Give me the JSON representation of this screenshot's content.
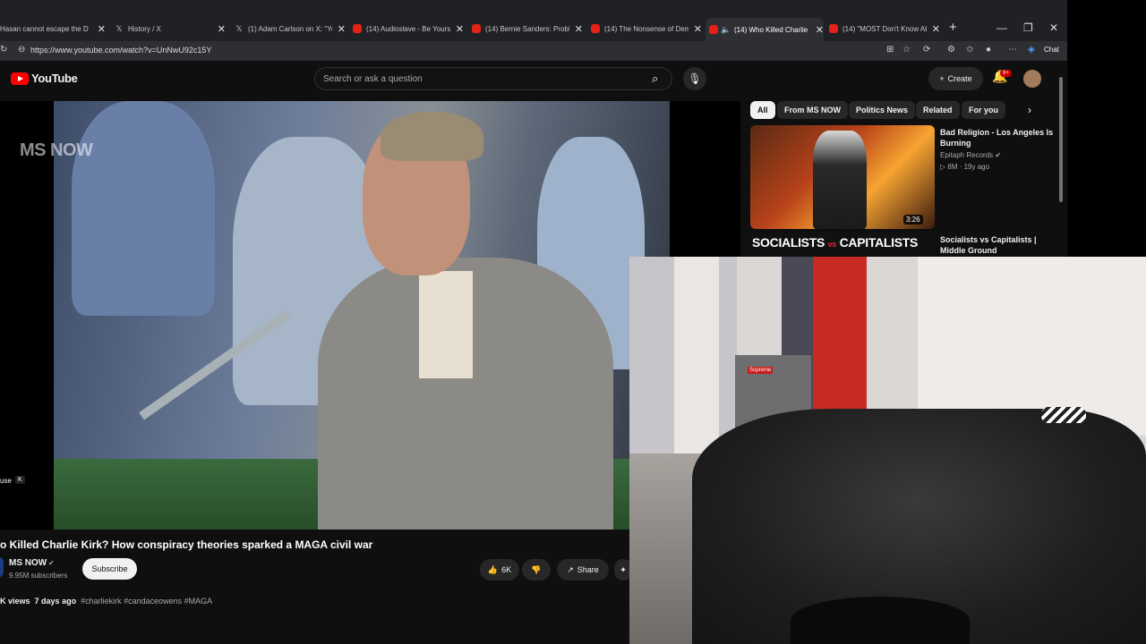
{
  "browser": {
    "tabs": [
      {
        "icon": "youtube",
        "title": "Hasan cannot escape the D"
      },
      {
        "icon": "x",
        "title": "History / X"
      },
      {
        "icon": "x",
        "title": "(1) Adam Carlson on X: \"Yo"
      },
      {
        "icon": "youtube",
        "title": "(14) Audioslave - Be Yoursel"
      },
      {
        "icon": "youtube",
        "title": "(14) Bernie Sanders: Problem"
      },
      {
        "icon": "youtube",
        "title": "(14) The Nonsense of Demo"
      },
      {
        "icon": "youtube",
        "title": "(14) Who Killed Charlie K",
        "active": true
      },
      {
        "icon": "youtube",
        "title": "(14) \"MOST Don't Know Abo"
      }
    ],
    "url": "https://www.youtube.com/watch?v=UnNwU92c15Y",
    "chat_label": "Chat"
  },
  "youtube": {
    "logo": "YouTube",
    "search_placeholder": "Search or ask a question",
    "create_label": "Create",
    "notifications_badge": "9+"
  },
  "video": {
    "watermark": "MS NOW",
    "pause_hint": "use",
    "pause_key": "K",
    "title": "o Killed Charlie Kirk? How conspiracy theories sparked a MAGA civil war",
    "channel": "MS NOW",
    "subscribers": "9.95M subscribers",
    "subscribe_label": "Subscribe",
    "likes": "6K",
    "share_label": "Share",
    "views": "K views",
    "age": "7 days ago",
    "hashtags": "#charliekirk #candaceowens #MAGA"
  },
  "sidebar": {
    "chips": [
      "All",
      "From MS NOW",
      "Politics News",
      "Related",
      "For you"
    ],
    "active_chip": "All",
    "recommendations": [
      {
        "title": "Bad Religion - Los Angeles Is Burning",
        "channel": "Epitaph Records",
        "stats": "8M · 19y ago",
        "duration": "3:26"
      },
      {
        "title": "Socialists vs Capitalists | Middle Ground",
        "thumb_left": "SOCIALISTS",
        "thumb_vs": "vs",
        "thumb_right": "CAPITALISTS"
      }
    ]
  },
  "webcam": {
    "fridge_label": "Supreme"
  },
  "colors": {
    "yt_red": "#ff0000",
    "background": "#0f0f0f",
    "chip_bg": "#272727"
  }
}
